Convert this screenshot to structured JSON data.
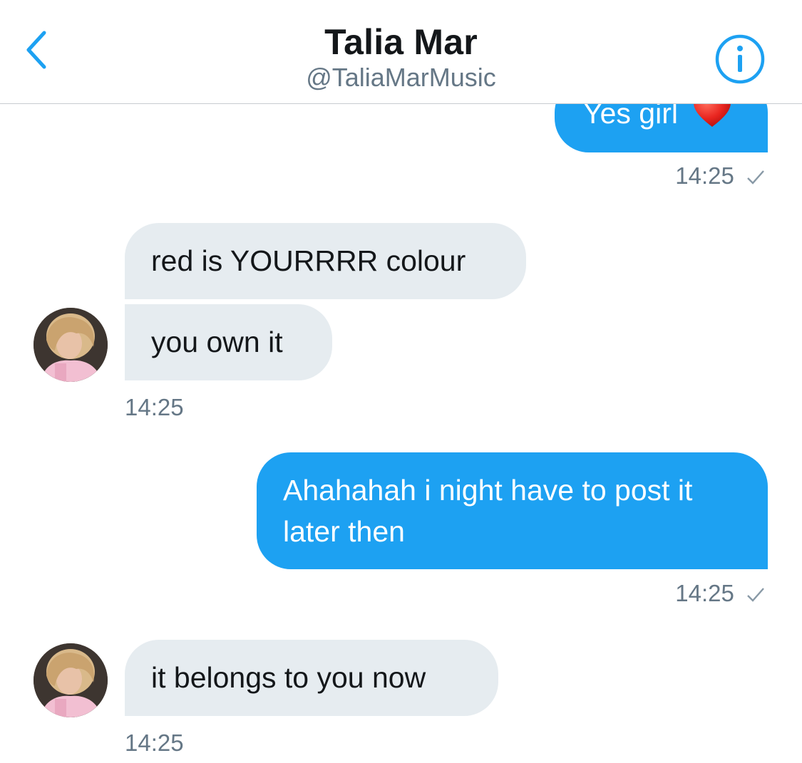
{
  "header": {
    "title": "Talia Mar",
    "handle": "@TaliaMarMusic"
  },
  "colors": {
    "accent": "#1da1f2",
    "incoming_bubble": "#e6ecf0",
    "timestamp": "#657786"
  },
  "icons": {
    "back": "chevron-left-icon",
    "info": "info-circle-icon",
    "read_receipt": "checkmark-icon",
    "emoji": "red-heart-emoji"
  },
  "messages": [
    {
      "direction": "outgoing",
      "text": "Yes girl",
      "emoji": "❤️"
    },
    {
      "direction": "outgoing_time",
      "time": "14:25"
    },
    {
      "direction": "incoming",
      "text": "red is YOURRRR colour"
    },
    {
      "direction": "incoming",
      "text": "you own it"
    },
    {
      "direction": "incoming_time",
      "time": "14:25"
    },
    {
      "direction": "outgoing",
      "text": "Ahahahah i night have to post it later then"
    },
    {
      "direction": "outgoing_time",
      "time": "14:25"
    },
    {
      "direction": "incoming",
      "text": "it belongs to you now"
    },
    {
      "direction": "incoming_time",
      "time": "14:25"
    }
  ]
}
